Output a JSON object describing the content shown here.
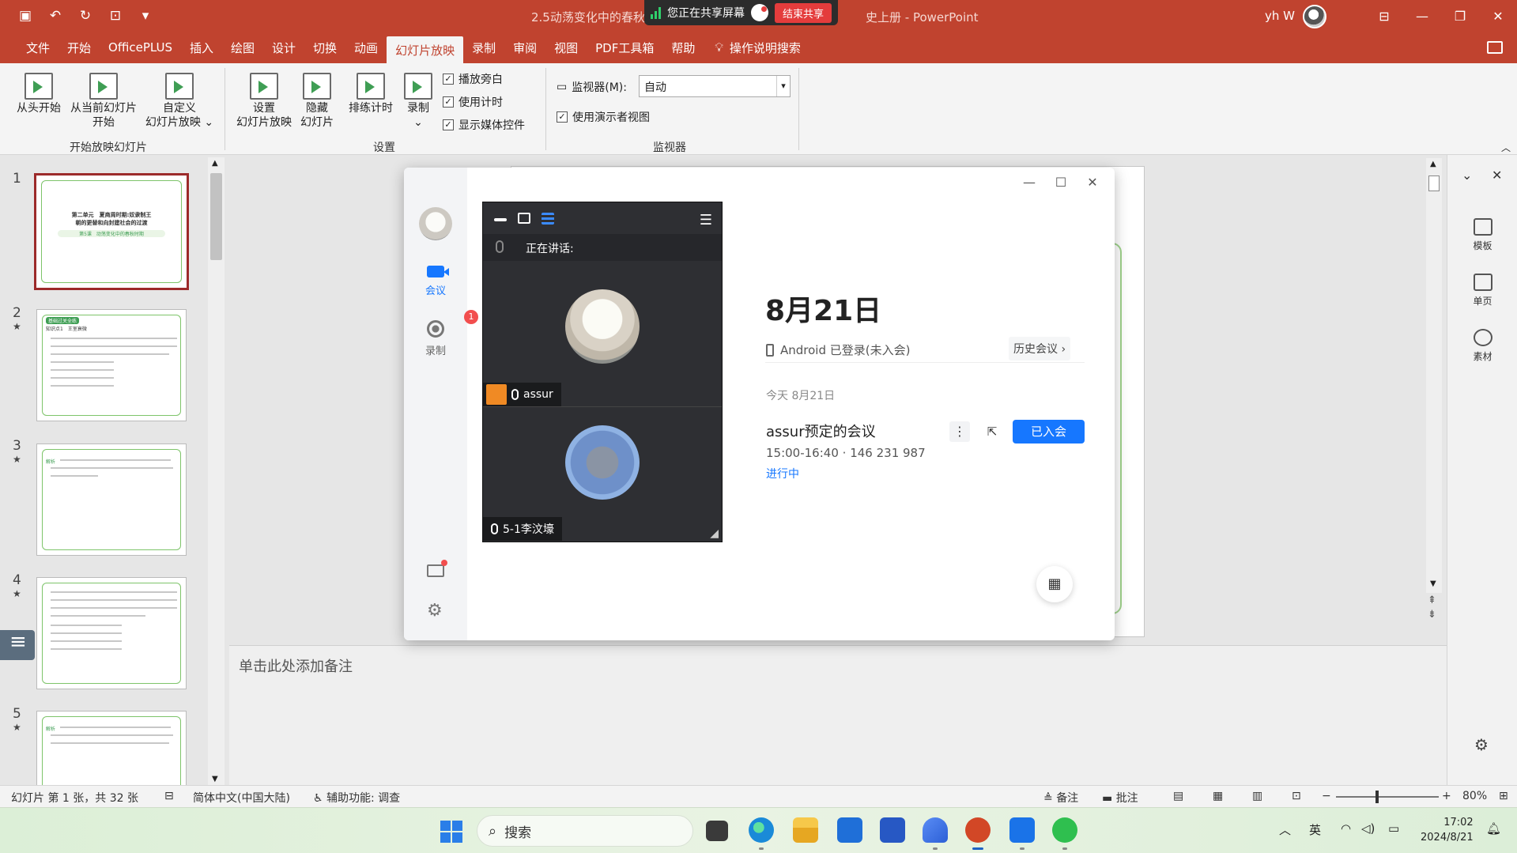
{
  "titlebar": {
    "doc_title_left": "2.5动荡变化中的春秋",
    "doc_title_right": "史上册  -  PowerPoint",
    "share_status": "您正在共享屏幕",
    "end_share": "结束共享",
    "user_name": "yh W"
  },
  "tabs": [
    "文件",
    "开始",
    "OfficePLUS",
    "插入",
    "绘图",
    "设计",
    "切换",
    "动画",
    "幻灯片放映",
    "录制",
    "审阅",
    "视图",
    "PDF工具箱",
    "帮助"
  ],
  "active_tab": "幻灯片放映",
  "tell_me": "操作说明搜索",
  "ribbon": {
    "from_start_l1": "从头开始",
    "from_current_l1": "从当前幻灯片",
    "from_current_l2": "开始",
    "custom_l1": "自定义",
    "custom_l2": "幻灯片放映",
    "group_start": "开始放映幻灯片",
    "setup_l1": "设置",
    "setup_l2": "幻灯片放映",
    "hide_l1": "隐藏",
    "hide_l2": "幻灯片",
    "rehearse": "排练计时",
    "record": "录制",
    "chk_narration": "播放旁白",
    "chk_timing": "使用计时",
    "chk_media": "显示媒体控件",
    "group_setup": "设置",
    "monitor_label": "监视器(M):",
    "monitor_value": "自动",
    "presenter_view": "使用演示者视图",
    "group_monitor": "监视器"
  },
  "thumbnails": [
    {
      "num": "1",
      "star": ""
    },
    {
      "num": "2",
      "star": "★"
    },
    {
      "num": "3",
      "star": "★"
    },
    {
      "num": "4",
      "star": "★"
    },
    {
      "num": "5",
      "star": "★"
    }
  ],
  "thumb1": {
    "title_line1": "第二单元　夏商周时期:奴隶制王",
    "title_line2": "朝的更替和向封建社会的过渡",
    "subtitle": "第5课　动荡变化中的春秋时期"
  },
  "thumb2": {
    "tag": "基础过关全练",
    "heading": "知识点1　王室衰微"
  },
  "thumb3": {
    "tag": "解析"
  },
  "thumb5": {
    "tag": "解析"
  },
  "notes_placeholder": "单击此处添加备注",
  "right_pane": {
    "templates": "模板",
    "single_page": "单页",
    "assets": "素材"
  },
  "meeting": {
    "side_meeting": "会议",
    "side_record": "录制",
    "record_badge": "1",
    "speaking_label": "正在讲话:",
    "participant1": "assur",
    "participant2": "5-1李汶壕",
    "date": "8月21日",
    "device_status": "Android 已登录(未入会)",
    "history": "历史会议",
    "today": "今天 8月21日",
    "meeting_title": "assur预定的会议",
    "meeting_time": "15:00-16:40",
    "meeting_sep": "·",
    "meeting_id": "146 231 987",
    "meeting_status": "进行中",
    "joined": "已入会"
  },
  "statusbar": {
    "slide_info": "幻灯片 第 1 张，共 32 张",
    "language": "简体中文(中国大陆)",
    "accessibility": "辅助功能: 调查",
    "notes": "备注",
    "comments": "批注",
    "zoom": "80%"
  },
  "taskbar": {
    "search": "搜索",
    "ime": "英",
    "time": "17:02",
    "date": "2024/8/21"
  },
  "colors": {
    "accent_red": "#c0432f",
    "meeting_blue": "#1677ff"
  }
}
